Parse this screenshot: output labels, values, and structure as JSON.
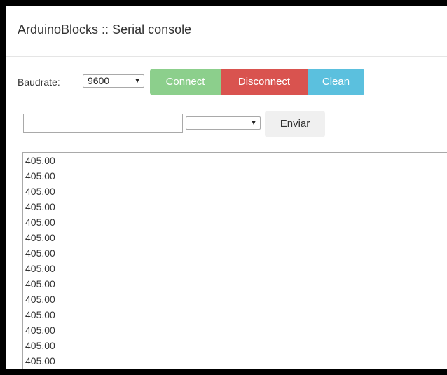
{
  "header": {
    "title": "ArduinoBlocks :: Serial console"
  },
  "controls": {
    "baudrate_label": "Baudrate:",
    "baudrate_value": "9600",
    "connect_label": "Connect",
    "disconnect_label": "Disconnect",
    "clean_label": "Clean"
  },
  "send": {
    "input_value": "",
    "line_ending_value": "",
    "send_label": "Enviar"
  },
  "console": {
    "lines": [
      "405.00",
      "405.00",
      "405.00",
      "405.00",
      "405.00",
      "405.00",
      "405.00",
      "405.00",
      "405.00",
      "405.00",
      "405.00",
      "405.00",
      "405.00",
      "405.00"
    ]
  },
  "colors": {
    "connect": "#8ccf8c",
    "disconnect": "#d9534f",
    "clean": "#5bc0de",
    "send": "#f0f0f0",
    "frame_border": "#000000"
  },
  "icons": {
    "dropdown": "dropdown-arrow-icon"
  }
}
